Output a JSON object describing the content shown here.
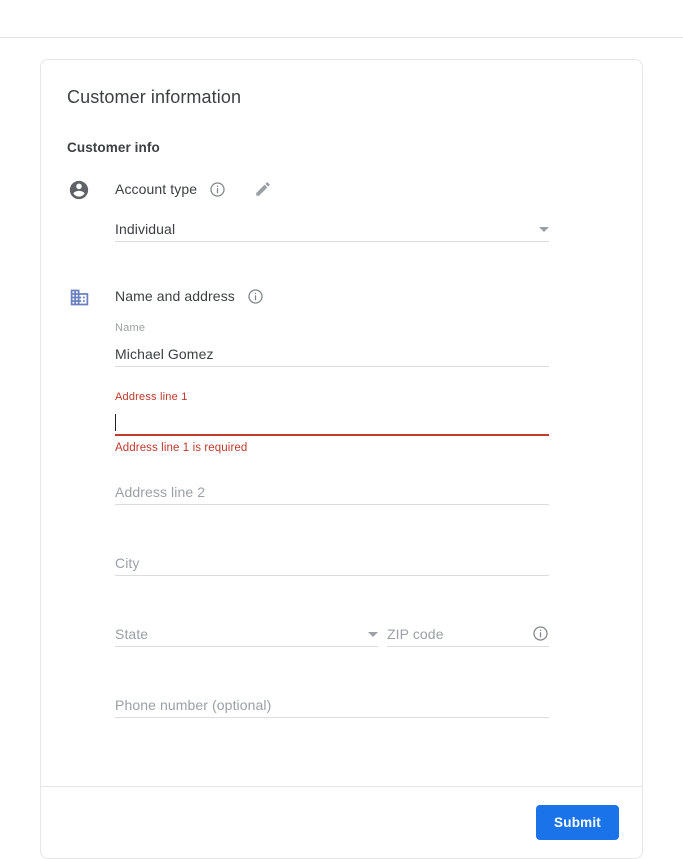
{
  "card": {
    "title": "Customer information",
    "section_title": "Customer info"
  },
  "account_type": {
    "icon": "account-circle-icon",
    "label": "Account type",
    "info_icon": "info-outline-icon",
    "edit_icon": "pencil-edit-icon",
    "selected_value": "Individual",
    "dropdown_icon": "chevron-down-icon"
  },
  "name_and_address": {
    "icon": "building-icon",
    "label": "Name and address",
    "info_icon": "info-outline-icon",
    "name": {
      "label": "Name",
      "value": "Michael Gomez"
    },
    "address_line_1": {
      "label": "Address line 1",
      "value": "",
      "error": "Address line 1 is required"
    },
    "address_line_2": {
      "placeholder": "Address line 2",
      "value": ""
    },
    "city": {
      "placeholder": "City",
      "value": ""
    },
    "state": {
      "placeholder": "State",
      "value": "",
      "dropdown_icon": "chevron-down-icon"
    },
    "zip_code": {
      "placeholder": "ZIP code",
      "value": "",
      "info_icon": "info-outline-icon"
    },
    "phone_number": {
      "placeholder": "Phone number (optional)",
      "value": ""
    }
  },
  "footer": {
    "submit_label": "Submit"
  },
  "colors": {
    "accent": "#1a73e8",
    "error": "#c0392b",
    "building_icon": "#6b80c0",
    "text_primary": "#3c4043",
    "text_muted": "#9aa0a6"
  }
}
